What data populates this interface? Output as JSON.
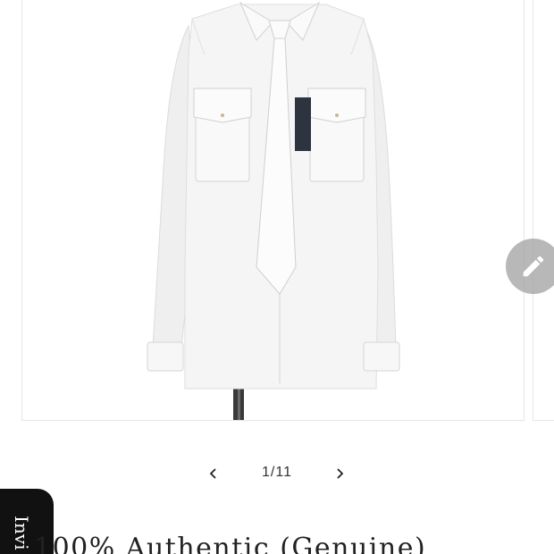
{
  "gallery": {
    "image_alt": "White shirt with matching white tie on mannequin",
    "edit_icon": "pencil-icon",
    "pager": {
      "prev_icon": "chevron-left-icon",
      "next_icon": "chevron-right-icon",
      "counter": "1/11"
    }
  },
  "invite_tab": {
    "label": "Invi"
  },
  "product": {
    "title": "100% Authentic (Genuine)"
  },
  "colors": {
    "edit_button_bg": "#a0a0a0",
    "invite_tab_bg": "#111111"
  }
}
